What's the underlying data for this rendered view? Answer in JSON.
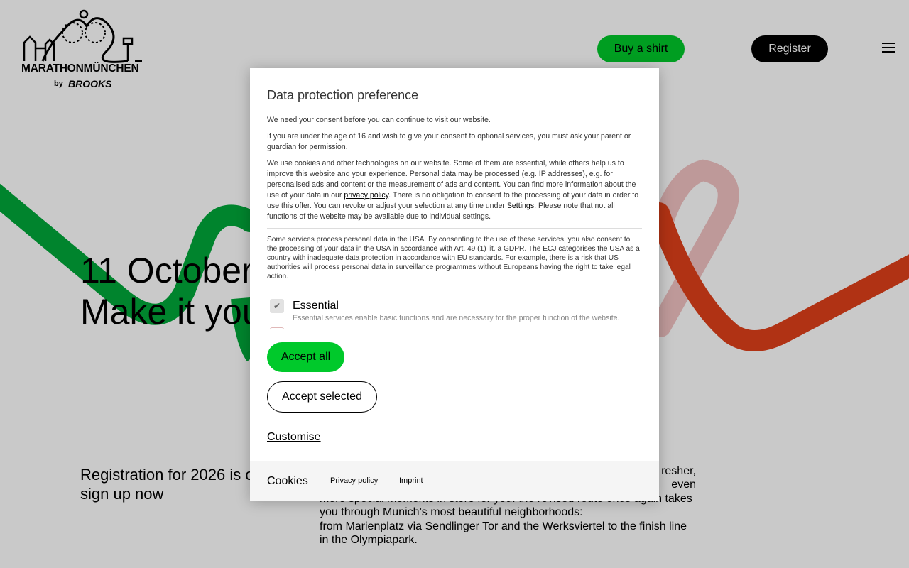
{
  "header": {
    "logo_text": "MARATHONMÜNCHEN",
    "logo_by": "by",
    "logo_brand": "BROOKS",
    "buy_shirt_label": "Buy a shirt",
    "register_label": "Register",
    "menu_icon": "hamburger-icon"
  },
  "hero": {
    "line1": "11 October",
    "line2": "Make it your"
  },
  "registration": {
    "text": "Registration for 2026 is ongoing – sign up now"
  },
  "body_text": {
    "line1": "resher,",
    "line2": "even",
    "line3": "more special moments in store for you: the revised route once again takes",
    "line4": "you through Munich’s most beautiful neighborhoods:",
    "line5": "from Marienplatz via Sendlinger Tor and the Werksviertel to the finish line",
    "line6": "in the Olympiapark."
  },
  "dialog": {
    "title": "Data protection preference",
    "p1": "We need your consent before you can continue to visit our website.",
    "p2": "If you are under the age of 16 and wish to give your consent to optional services, you must ask your parent or guardian for permission.",
    "p3_a": "We use cookies and other technologies on our website. Some of them are essential, while others help us to improve this website and your experience. Personal data may be processed (e.g. IP addresses), e.g. for personalised ads and content or the measurement of ads and content. You can find more information about the use of your data in our ",
    "p3_link1": "privacy policy",
    "p3_b": ". There is no obligation to consent to the processing of your data in order to use this offer. You can revoke or adjust your selection at any time under ",
    "p3_link2": "Settings",
    "p3_c": ". Please note that not all functions of the website may be available due to individual settings.",
    "usa": "Some services process personal data in the USA. By consenting to the use of these services, you also consent to the processing of your data in the USA in accordance with Art. 49 (1) lit. a GDPR. The ECJ categorises the USA as a country with inadequate data protection in accordance with EU standards. For example, there is a risk that US authorities will process personal data in surveillance programmes without Europeans having the right to take legal action.",
    "service_name": "Essential",
    "service_desc": "Essential services enable basic functions and are necessary for the proper function of the website.",
    "service_checked": true,
    "accept_all": "Accept all",
    "accept_selected": "Accept selected",
    "customise": "Customise",
    "footer_title": "Cookies",
    "footer_privacy": "Privacy policy",
    "footer_imprint": "Imprint"
  },
  "colors": {
    "brand_green": "#00c92b",
    "route_green": "#00a83a",
    "route_red": "#e0401a",
    "route_pink": "#f2c3c3"
  }
}
